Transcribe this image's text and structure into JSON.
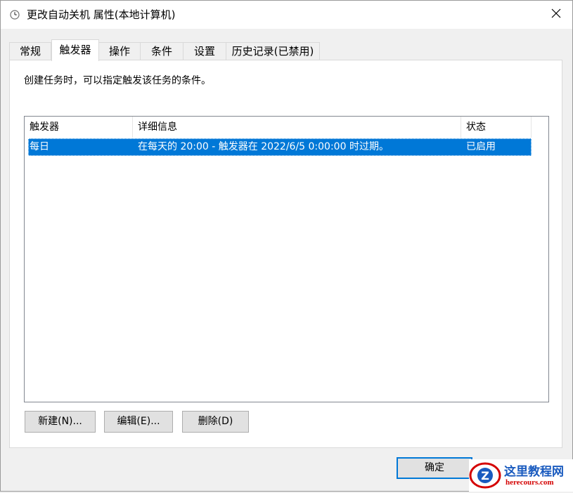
{
  "window": {
    "title": "更改自动关机 属性(本地计算机)",
    "close_glyph": "✕"
  },
  "tabs": [
    {
      "label": "常规"
    },
    {
      "label": "触发器"
    },
    {
      "label": "操作"
    },
    {
      "label": "条件"
    },
    {
      "label": "设置"
    },
    {
      "label": "历史记录(已禁用)"
    }
  ],
  "active_tab": "触发器",
  "panel": {
    "description": "创建任务时，可以指定触发该任务的条件。"
  },
  "triggers_list": {
    "columns": [
      "触发器",
      "详细信息",
      "状态"
    ],
    "rows": [
      {
        "trigger": "每日",
        "details": "在每天的 20:00 - 触发器在 2022/6/5 0:00:00 时过期。",
        "status": "已启用",
        "selected": true
      }
    ]
  },
  "buttons": {
    "new": "新建(N)...",
    "edit": "编辑(E)...",
    "delete": "删除(D)",
    "ok": "确定"
  },
  "watermark": {
    "title": "这里教程网",
    "url": "herecours.com"
  },
  "colors": {
    "selection": "#0078d7",
    "window_bg": "#f0f0f0",
    "panel_bg": "#ffffff",
    "primary_border": "#0078d7",
    "watermark_red": "#d40000",
    "watermark_blue": "#1a5bbf"
  },
  "icons": {
    "title": "clock-icon",
    "close": "close-icon",
    "watermark": "z-logo-icon"
  }
}
